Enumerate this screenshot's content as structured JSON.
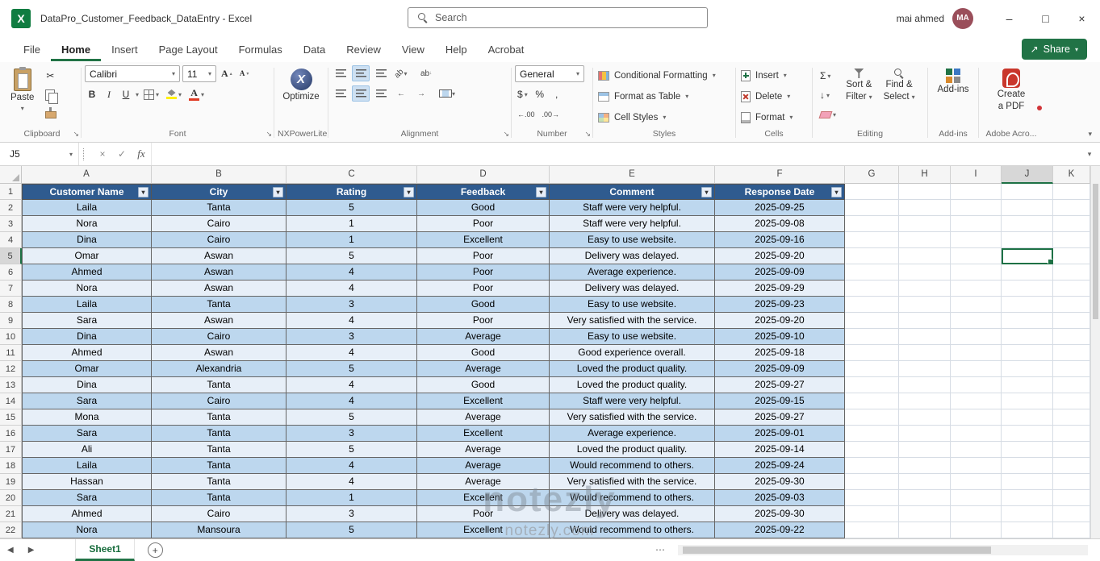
{
  "title_bar": {
    "app_letter": "X",
    "title": "DataPro_Customer_Feedback_DataEntry  -  Excel",
    "search_placeholder": "Search",
    "user_name": "mai ahmed",
    "user_initials": "MA"
  },
  "tabs": {
    "items": [
      "File",
      "Home",
      "Insert",
      "Page Layout",
      "Formulas",
      "Data",
      "Review",
      "View",
      "Help",
      "Acrobat"
    ],
    "active": "Home",
    "share": "Share"
  },
  "ribbon": {
    "clipboard": {
      "group": "Clipboard",
      "paste": "Paste"
    },
    "font": {
      "group": "Font",
      "name": "Calibri",
      "size": "11",
      "bold": "B",
      "italic": "I",
      "underline": "U",
      "grow": "A",
      "shrink": "A",
      "color_letter": "A"
    },
    "nxpowerlite": {
      "group": "NXPowerLite",
      "logo": "X",
      "optimize": "Optimize"
    },
    "alignment": {
      "group": "Alignment"
    },
    "number": {
      "group": "Number",
      "format": "General",
      "currency": "$",
      "percent": "%",
      "comma": ",",
      "increase_decimal": "←.00",
      "decrease_decimal": ".00→"
    },
    "styles": {
      "group": "Styles",
      "conditional": "Conditional Formatting",
      "format_table": "Format as Table",
      "cell_styles": "Cell Styles"
    },
    "cells": {
      "group": "Cells",
      "insert": "Insert",
      "delete": "Delete",
      "format": "Format"
    },
    "editing": {
      "group": "Editing",
      "autosum": "Σ",
      "sort_line1": "Sort &",
      "sort_line2": "Filter",
      "find_line1": "Find &",
      "find_line2": "Select"
    },
    "addins": {
      "group": "Add-ins",
      "button": "Add-ins"
    },
    "adobe": {
      "group": "Adobe Acro...",
      "line1": "Create",
      "line2": "a PDF"
    }
  },
  "formula_bar": {
    "name_box": "J5",
    "formula": ""
  },
  "grid": {
    "columns": [
      "A",
      "B",
      "C",
      "D",
      "E",
      "F",
      "G",
      "H",
      "I",
      "J",
      "K"
    ],
    "selected_column": "J",
    "selected_row": 5,
    "headers": [
      "Customer Name",
      "City",
      "Rating",
      "Feedback",
      "Comment",
      "Response Date"
    ],
    "rows": [
      [
        "Laila",
        "Tanta",
        "5",
        "Good",
        "Staff were very helpful.",
        "2025-09-25"
      ],
      [
        "Nora",
        "Cairo",
        "1",
        "Poor",
        "Staff were very helpful.",
        "2025-09-08"
      ],
      [
        "Dina",
        "Cairo",
        "1",
        "Excellent",
        "Easy to use website.",
        "2025-09-16"
      ],
      [
        "Omar",
        "Aswan",
        "5",
        "Poor",
        "Delivery was delayed.",
        "2025-09-20"
      ],
      [
        "Ahmed",
        "Aswan",
        "4",
        "Poor",
        "Average experience.",
        "2025-09-09"
      ],
      [
        "Nora",
        "Aswan",
        "4",
        "Poor",
        "Delivery was delayed.",
        "2025-09-29"
      ],
      [
        "Laila",
        "Tanta",
        "3",
        "Good",
        "Easy to use website.",
        "2025-09-23"
      ],
      [
        "Sara",
        "Aswan",
        "4",
        "Poor",
        "Very satisfied with the service.",
        "2025-09-20"
      ],
      [
        "Dina",
        "Cairo",
        "3",
        "Average",
        "Easy to use website.",
        "2025-09-10"
      ],
      [
        "Ahmed",
        "Aswan",
        "4",
        "Good",
        "Good experience overall.",
        "2025-09-18"
      ],
      [
        "Omar",
        "Alexandria",
        "5",
        "Average",
        "Loved the product quality.",
        "2025-09-09"
      ],
      [
        "Dina",
        "Tanta",
        "4",
        "Good",
        "Loved the product quality.",
        "2025-09-27"
      ],
      [
        "Sara",
        "Cairo",
        "4",
        "Excellent",
        "Staff were very helpful.",
        "2025-09-15"
      ],
      [
        "Mona",
        "Tanta",
        "5",
        "Average",
        "Very satisfied with the service.",
        "2025-09-27"
      ],
      [
        "Sara",
        "Tanta",
        "3",
        "Excellent",
        "Average experience.",
        "2025-09-01"
      ],
      [
        "Ali",
        "Tanta",
        "5",
        "Average",
        "Loved the product quality.",
        "2025-09-14"
      ],
      [
        "Laila",
        "Tanta",
        "4",
        "Average",
        "Would recommend to others.",
        "2025-09-24"
      ],
      [
        "Hassan",
        "Tanta",
        "4",
        "Average",
        "Very satisfied with the service.",
        "2025-09-30"
      ],
      [
        "Sara",
        "Tanta",
        "1",
        "Excellent",
        "Would recommend to others.",
        "2025-09-03"
      ],
      [
        "Ahmed",
        "Cairo",
        "3",
        "Poor",
        "Delivery was delayed.",
        "2025-09-30"
      ],
      [
        "Nora",
        "Mansoura",
        "5",
        "Excellent",
        "Would recommend to others.",
        "2025-09-22"
      ]
    ]
  },
  "sheet_bar": {
    "sheet": "Sheet1"
  },
  "watermark": {
    "logo": "notezly",
    "site": "notezly.com"
  },
  "colors": {
    "accent_green": "#217346",
    "table_header_blue": "#2F5B8F",
    "band_blue": "#BDD7EE",
    "selection_green": "#1E7145"
  },
  "icons": {
    "dropdown": "▾",
    "launcher": "↘",
    "minimize": "–",
    "maximize": "□",
    "close": "×",
    "cancel": "×",
    "check": "✓",
    "fx": "fx",
    "scissors": "✂",
    "up_small": "▴",
    "down_small": "▾",
    "down_arrow": "↓",
    "share_arrow": "↗",
    "prev": "◀",
    "next": "▶",
    "plus": "+",
    "dots": "⋯",
    "orientation_text": "ab",
    "wrap_text": "ab",
    "outdent": "←",
    "indent": "→"
  }
}
